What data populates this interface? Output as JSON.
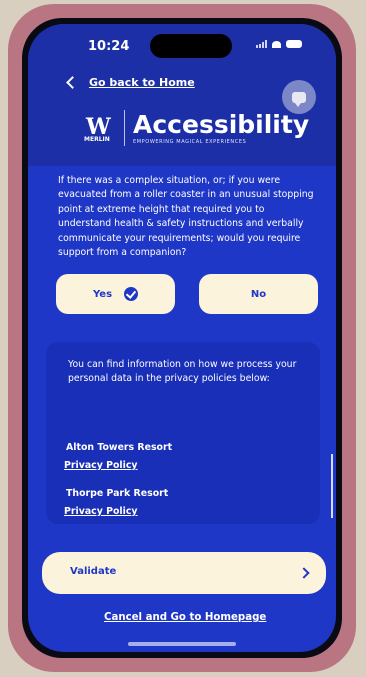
{
  "status_bar": {
    "time": "10:24"
  },
  "header": {
    "back_label": "Go back to Home",
    "brand_name": "Accessibility",
    "brand_tagline": "EMPOWERING MAGICAL EXPERIENCES",
    "logo_text": "MERLIN",
    "chat_icon": "chat-bubble-icon"
  },
  "question": {
    "text": "If there was a complex situation, or; if you were evacuated from a roller coaster in an unusual stopping point at extreme height that required you to understand health & safety instructions and verbally communicate your requirements; would you require support from a companion?"
  },
  "answers": {
    "yes_label": "Yes",
    "no_label": "No",
    "selected": "Yes"
  },
  "privacy": {
    "intro": "You can find information on how we process your personal data in the privacy policies below:",
    "resorts": [
      {
        "name": "Alton Towers Resort",
        "link": "Privacy Policy"
      },
      {
        "name": "Thorpe Park Resort",
        "link": "Privacy Policy"
      }
    ]
  },
  "footer": {
    "validate_label": "Validate",
    "cancel_label": "Cancel and Go to Homepage"
  },
  "colors": {
    "primary_blue": "#1f37c6",
    "button_cream": "#fbf3dc",
    "phone_case": "#b97682"
  }
}
